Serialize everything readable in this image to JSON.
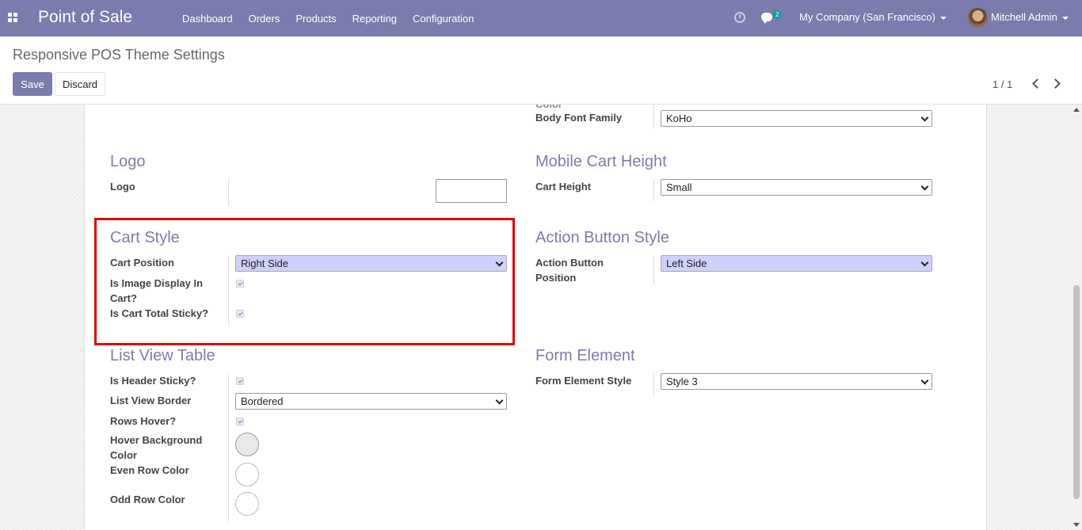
{
  "navbar": {
    "app_title": "Point of Sale",
    "menu": [
      "Dashboard",
      "Orders",
      "Products",
      "Reporting",
      "Configuration"
    ],
    "chat_count": "2",
    "company": "My Company (San Francisco)",
    "user": "Mitchell Admin"
  },
  "control_panel": {
    "breadcrumb": "Responsive POS Theme Settings",
    "save_label": "Save",
    "discard_label": "Discard",
    "pager": "1 / 1"
  },
  "form": {
    "cut_label": "Color",
    "body_font": {
      "label": "Body Font Family",
      "value": "KoHo"
    },
    "logo": {
      "title": "Logo",
      "label": "Logo"
    },
    "mobile_cart": {
      "title": "Mobile Cart Height",
      "label": "Cart Height",
      "value": "Small"
    },
    "cart_style": {
      "title": "Cart Style",
      "position_label": "Cart Position",
      "position_value": "Right Side",
      "image_label": "Is Image Display In Cart?",
      "sticky_label": "Is Cart Total Sticky?"
    },
    "action_button": {
      "title": "Action Button Style",
      "label": "Action Button Position",
      "value": "Left Side"
    },
    "list_view": {
      "title": "List View Table",
      "header_sticky_label": "Is Header Sticky?",
      "border_label": "List View Border",
      "border_value": "Bordered",
      "rows_hover_label": "Rows Hover?",
      "hover_bg_label": "Hover Background Color",
      "even_row_label": "Even Row Color",
      "odd_row_label": "Odd Row Color"
    },
    "form_element": {
      "title": "Form Element",
      "label": "Form Element Style",
      "value": "Style 3"
    }
  }
}
